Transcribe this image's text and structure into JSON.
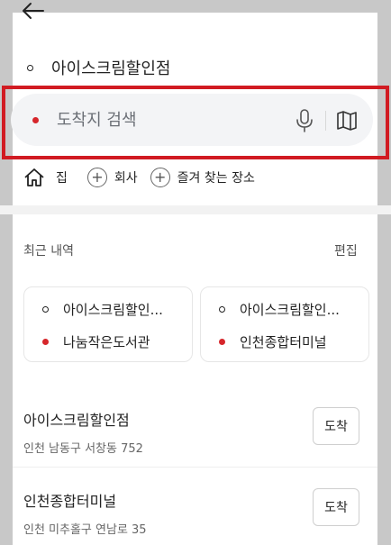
{
  "route": {
    "origin": "아이스크림할인점",
    "destination_placeholder": "도착지 검색"
  },
  "shortcuts": [
    {
      "label": "집",
      "icon": "home-icon"
    },
    {
      "label": "회사",
      "icon": "plus-icon"
    },
    {
      "label": "즐겨 찾는 장소",
      "icon": "plus-icon"
    }
  ],
  "recent": {
    "header": "최근 내역",
    "edit_label": "편집",
    "cards": [
      {
        "from": "아이스크림할인...",
        "to": "나눔작은도서관"
      },
      {
        "from": "아이스크림할인...",
        "to": "인천종합터미널"
      }
    ],
    "places": [
      {
        "name": "아이스크림할인점",
        "address": "인천 남동구 서창동 752",
        "button": "도착"
      },
      {
        "name": "인천종합터미널",
        "address": "인천 미추홀구 연남로 35",
        "button": "도착"
      }
    ]
  },
  "colors": {
    "accent_red": "#d6262b",
    "highlight_frame": "#d11b22"
  }
}
